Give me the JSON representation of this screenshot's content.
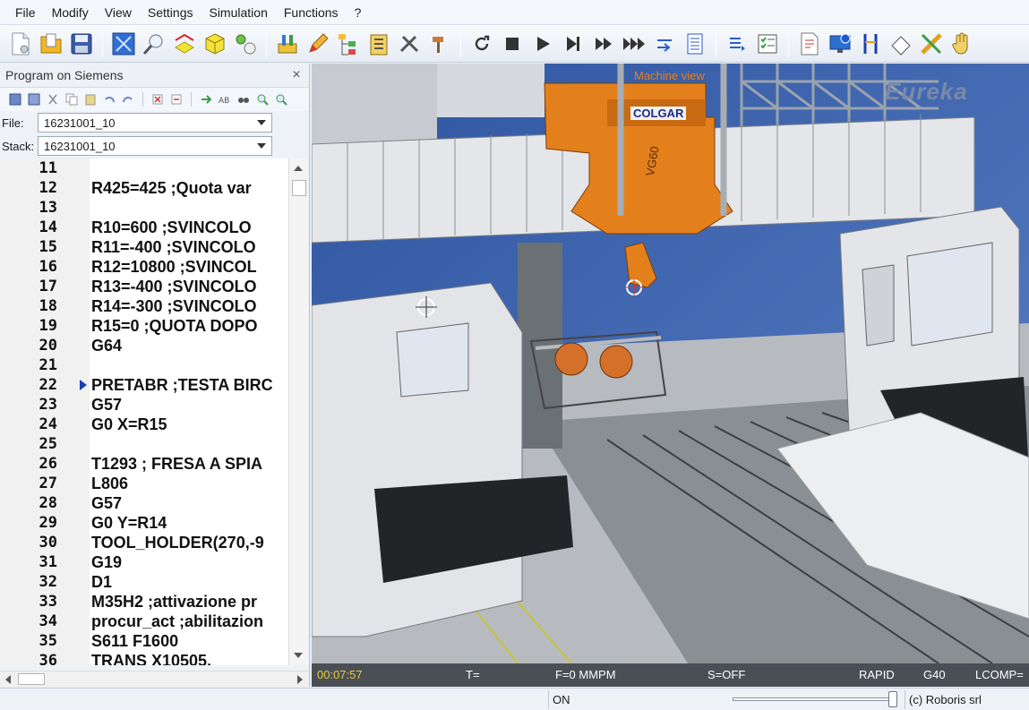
{
  "menu": [
    "File",
    "Modify",
    "View",
    "Settings",
    "Simulation",
    "Functions",
    "?"
  ],
  "left_panel": {
    "title": "Program on Siemens",
    "file_label": "File:",
    "file_value": "16231001_10",
    "stack_label": "Stack:",
    "stack_value": "16231001_10",
    "current_line": 22,
    "lines": [
      {
        "num": "11",
        "text": ""
      },
      {
        "num": "12",
        "text": "R425=425 ;Quota var"
      },
      {
        "num": "13",
        "text": ""
      },
      {
        "num": "14",
        "text": "R10=600 ;SVINCOLO"
      },
      {
        "num": "15",
        "text": "R11=-400 ;SVINCOLO"
      },
      {
        "num": "16",
        "text": "R12=10800 ;SVINCOL"
      },
      {
        "num": "17",
        "text": "R13=-400 ;SVINCOLO"
      },
      {
        "num": "18",
        "text": "R14=-300 ;SVINCOLO"
      },
      {
        "num": "19",
        "text": "R15=0 ;QUOTA DOPO"
      },
      {
        "num": "20",
        "text": "G64"
      },
      {
        "num": "21",
        "text": ""
      },
      {
        "num": "22",
        "text": "PRETABR ;TESTA BIRC"
      },
      {
        "num": "23",
        "text": "G57"
      },
      {
        "num": "24",
        "text": "G0 X=R15"
      },
      {
        "num": "25",
        "text": ""
      },
      {
        "num": "26",
        "text": "T1293 ; FRESA A  SPIA"
      },
      {
        "num": "27",
        "text": "L806"
      },
      {
        "num": "28",
        "text": "G57"
      },
      {
        "num": "29",
        "text": "G0 Y=R14"
      },
      {
        "num": "30",
        "text": "TOOL_HOLDER(270,-9"
      },
      {
        "num": "31",
        "text": "G19"
      },
      {
        "num": "32",
        "text": "D1"
      },
      {
        "num": "33",
        "text": "M35H2 ;attivazione pr"
      },
      {
        "num": "34",
        "text": "procur_act ;abilitazion"
      },
      {
        "num": "35",
        "text": "S611 F1600"
      },
      {
        "num": "36",
        "text": "TRANS X10505."
      }
    ]
  },
  "viewport": {
    "title": "Machine view",
    "logo": "Eureka",
    "machine_brand": "COLGAR",
    "head_label": "VG60",
    "status": {
      "time": "00:07:57",
      "tool": "T=",
      "feed": "F=0 MMPM",
      "spindle": "S=OFF",
      "mode": "RAPID",
      "gcode": "G40",
      "lcomp": "LCOMP="
    }
  },
  "bottom_bar": {
    "state": "ON",
    "copyright": "(c) Roboris srl"
  },
  "toolbar_icons": [
    "new-file-icon",
    "open-folder-icon",
    "save-icon",
    "fit-view-icon",
    "zoom-icon",
    "section-icon",
    "cube-view-icon",
    "components-icon",
    "tooling-icon",
    "edit-icon",
    "tree-icon",
    "clipboard-icon",
    "tools-icon",
    "hammer-icon",
    "reset-icon",
    "stop-icon",
    "play-icon",
    "step-icon",
    "fast-forward-icon",
    "fastest-icon",
    "jump-icon",
    "list-icon",
    "list-right-icon",
    "checklist-icon",
    "report-icon",
    "monitor-info-icon",
    "calipers-icon",
    "eraser-icon",
    "pencil-ruler-icon",
    "hand-icon"
  ]
}
